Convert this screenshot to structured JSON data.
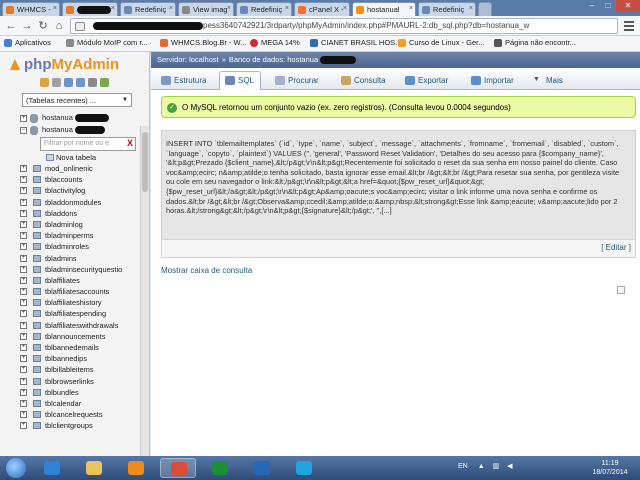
{
  "browser": {
    "tabs": [
      {
        "label": "WHMCS -",
        "active": false
      },
      {
        "label": "",
        "active": false
      },
      {
        "label": "Redefiniç",
        "active": false
      },
      {
        "label": "View imag",
        "active": false
      },
      {
        "label": "Redefiniç",
        "active": false
      },
      {
        "label": "cPanel X -",
        "active": false
      },
      {
        "label": "hostanual",
        "active": true
      },
      {
        "label": "Redefiniç",
        "active": false
      }
    ],
    "url": "pess3640742921/3rdparty/phpMyAdmin/index.php#PMAURL-2:db_sql.php?db=hostanua_w",
    "bookmarks": [
      {
        "label": "Aplicativos",
        "color": "#4a7fd4"
      },
      {
        "label": "Módulo MoIP com r...",
        "color": "#8a8a8a"
      },
      {
        "label": "WHMCS.Blog.Br - W...",
        "color": "#e26b2b"
      },
      {
        "label": "MEGA 14%",
        "color": "#d9272e"
      },
      {
        "label": "CIANET BRASIL HOS...",
        "color": "#2f6db5"
      },
      {
        "label": "Curso de Linux - Ger...",
        "color": "#f0a020"
      },
      {
        "label": "Página não encontr...",
        "color": "#555555"
      }
    ]
  },
  "pma": {
    "logo_php": "php",
    "logo_my": "MyAdmin",
    "recent_tables": "(Tabelas recentes) ...",
    "db1": "hostanua",
    "db2": "hostanua",
    "filter_placeholder": "Filtrar por nome ou e",
    "filter_clear": "X",
    "new_table": "Nova tabela",
    "tables": [
      "mod_onlinenic",
      "tblaccounts",
      "tblactivitylog",
      "tbladdonmodules",
      "tbladdons",
      "tbladminlog",
      "tbladminperms",
      "tbladminroles",
      "tbladmins",
      "tbladminsecurityquestio",
      "tblaffiliates",
      "tblaffiliatesaccounts",
      "tblaffiliateshistory",
      "tblaffiliatespending",
      "tblaffiliateswithdrawals",
      "tblannouncements",
      "tblbannedemails",
      "tblbannedips",
      "tblbillableitems",
      "tblbrowserlinks",
      "tblbundles",
      "tblcalendar",
      "tblcancelrequests",
      "tblclientgroups"
    ],
    "breadcrumb": {
      "server": "Servidor: localhost",
      "sep": "»",
      "database": "Banco de dados: hostanua"
    },
    "menu": [
      {
        "label": "Estrutura",
        "color": "#7d9bc2"
      },
      {
        "label": "SQL",
        "color": "#6b87b6"
      },
      {
        "label": "Procurar",
        "color": "#a3b1c8"
      },
      {
        "label": "Consulta",
        "color": "#c8a660"
      },
      {
        "label": "Exportar",
        "color": "#5f8fc8"
      },
      {
        "label": "Importar",
        "color": "#5f8fc8"
      },
      {
        "label": "Mais",
        "color": "#8a8a8a"
      }
    ],
    "success_message": "O MySQL retornou um conjunto vazio (ex. zero registros). (Consulta levou 0.0004 segundos)",
    "sql_query": "INSERT INTO `tblemailtemplates` (`id`, `type`, `name`, `subject`, `message`, `attachments`, `fromname`, `fromemail`, `disabled`, `custom`, `language`, `copyto`, `plaintext`) VALUES\n('', 'general', 'Password Reset Validation', 'Detalhes do seu acesso para {$company_name}', '&lt;p&gt;Prezado {$client_name},&lt;/p&gt;\\r\\n&lt;p&gt;Recentemente foi solicitado o reset da sua senha em nosso painel do cliente. Caso voc&amp;ecirc; n&amp;atilde;o tenha solicitado, basta ignorar esse email.&lt;br /&gt;&lt;br /&gt;Para resetar sua senha, por gentileza visite ou cole em seu navegador o link:&lt;/p&gt;\\r\\n&lt;p&gt;&lt;a href=&quot;{$pw_reset_url}&quot;&gt;{$pw_reset_url}&lt;/a&gt;&lt;/p&gt;\\r\\n&lt;p&gt;Ap&amp;oacute;s voc&amp;ecirc; visitar o link informe uma nova senha e confirme os dados.&lt;br /&gt;&lt;br /&gt;Observa&amp;ccedil;&amp;atilde;o:&amp;nbsp;&lt;strong&gt;Esse link &amp;eacute; v&amp;aacute;lido por 2 horas.&lt;/strong&gt;&lt;/p&gt;\\r\\n&lt;p&gt;{$signature}&lt;/p&gt;', '',[...]",
    "edit_label": "[ Editar ]",
    "query_box_label": "Mostrar caixa de consulta"
  },
  "taskbar": {
    "apps": [
      {
        "name": "internet-explorer",
        "color": "#2f82d6",
        "active": false
      },
      {
        "name": "file-explorer",
        "color": "#e8c25a",
        "active": false
      },
      {
        "name": "media-player",
        "color": "#f08a1c",
        "active": false
      },
      {
        "name": "chrome",
        "color": "#dd4b39",
        "active": true
      },
      {
        "name": "hao123",
        "color": "#1b8f3a",
        "active": false
      },
      {
        "name": "outlook",
        "color": "#2468b8",
        "active": false
      },
      {
        "name": "skype",
        "color": "#20a3e0",
        "active": false
      }
    ],
    "language": "EN",
    "time": "11:19",
    "date": "18/07/2014"
  }
}
